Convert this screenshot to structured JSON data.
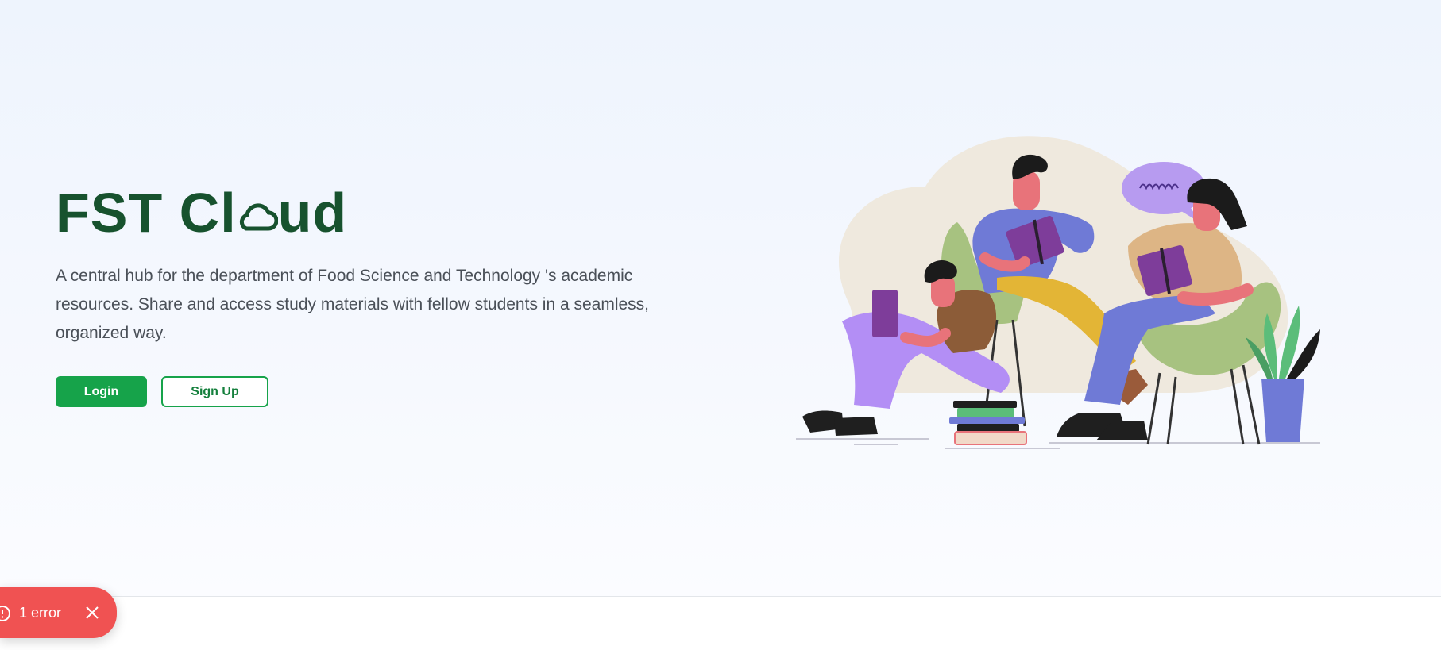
{
  "hero": {
    "title_before": "FST Cl",
    "title_after": "ud",
    "description": "A central hub for the department of Food Science and Technology 's academic resources. Share and access study materials with fellow students in a seamless, organized way.",
    "login_label": "Login",
    "signup_label": "Sign Up"
  },
  "icons": {
    "title_o": "cloud-icon",
    "toast_status": "alert-circle-icon",
    "toast_dismiss": "close-icon"
  },
  "toast": {
    "label": "1 error"
  },
  "colors": {
    "brand_green": "#17522e",
    "button_green": "#16a34a",
    "error_red": "#f05252",
    "text_gray": "#4a5058"
  }
}
